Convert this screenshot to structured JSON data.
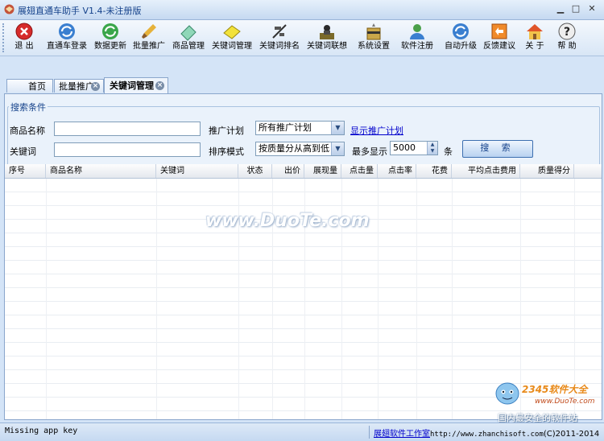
{
  "window": {
    "title": "展翅直通车助手 V1.4-未注册版",
    "controls": [
      "▁",
      "□",
      "✕"
    ]
  },
  "toolbar": {
    "buttons": [
      {
        "label": "退  出",
        "icon": "exit-icon"
      },
      {
        "label": "直通车登录",
        "icon": "refresh-login-icon"
      },
      {
        "label": "数据更新",
        "icon": "update-icon"
      },
      {
        "label": "批量推广",
        "icon": "brush-icon"
      },
      {
        "label": "商品管理",
        "icon": "eraser-icon"
      },
      {
        "label": "关键词管理",
        "icon": "note-icon"
      },
      {
        "label": "关键词排名",
        "icon": "ranking-icon"
      },
      {
        "label": "关键词联想",
        "icon": "thinker-icon"
      },
      {
        "label": "系统设置",
        "icon": "settings-icon"
      },
      {
        "label": "软件注册",
        "icon": "user-icon"
      },
      {
        "label": "自动升级",
        "icon": "upgrade-icon"
      },
      {
        "label": "反馈建议",
        "icon": "feedback-icon"
      },
      {
        "label": "关  于",
        "icon": "home-icon"
      },
      {
        "label": "帮  助",
        "icon": "help-icon"
      }
    ]
  },
  "tabs": [
    {
      "label": "首页",
      "active": false
    },
    {
      "label": "批量推广",
      "active": false
    },
    {
      "label": "关键词管理",
      "active": true
    }
  ],
  "search": {
    "legend": "搜索条件",
    "product_name_label": "商品名称",
    "product_name_value": "",
    "keyword_label": "关键词",
    "keyword_value": "",
    "plan_label": "推广计划",
    "plan_value": "所有推广计划",
    "show_plan_link": "显示推广计划",
    "sort_label": "排序模式",
    "sort_value": "按质量分从高到低",
    "max_label": "最多显示",
    "max_value": "5000",
    "max_unit": "条",
    "search_button": "搜 索"
  },
  "grid": {
    "columns": [
      "序号",
      "商品名称",
      "关键词",
      "状态",
      "出价",
      "展现量",
      "点击量",
      "点击率",
      "花费",
      "平均点击费用",
      "质量得分"
    ],
    "rows": []
  },
  "watermark": "www.DuoTe.com",
  "site_logo": {
    "text": "2345软件大全",
    "url_text": "www.DuoTe.com",
    "slogan": "国内最安全的软件站"
  },
  "status": {
    "left": "Missing app key",
    "studio": "展翅软件工作室",
    "site": "http://www.zhanchisoft.com",
    "copyright": "(C)2011-2014"
  },
  "colors": {
    "title_text": "#15428b",
    "link": "#0000cc",
    "background": "#d4e4f7"
  }
}
